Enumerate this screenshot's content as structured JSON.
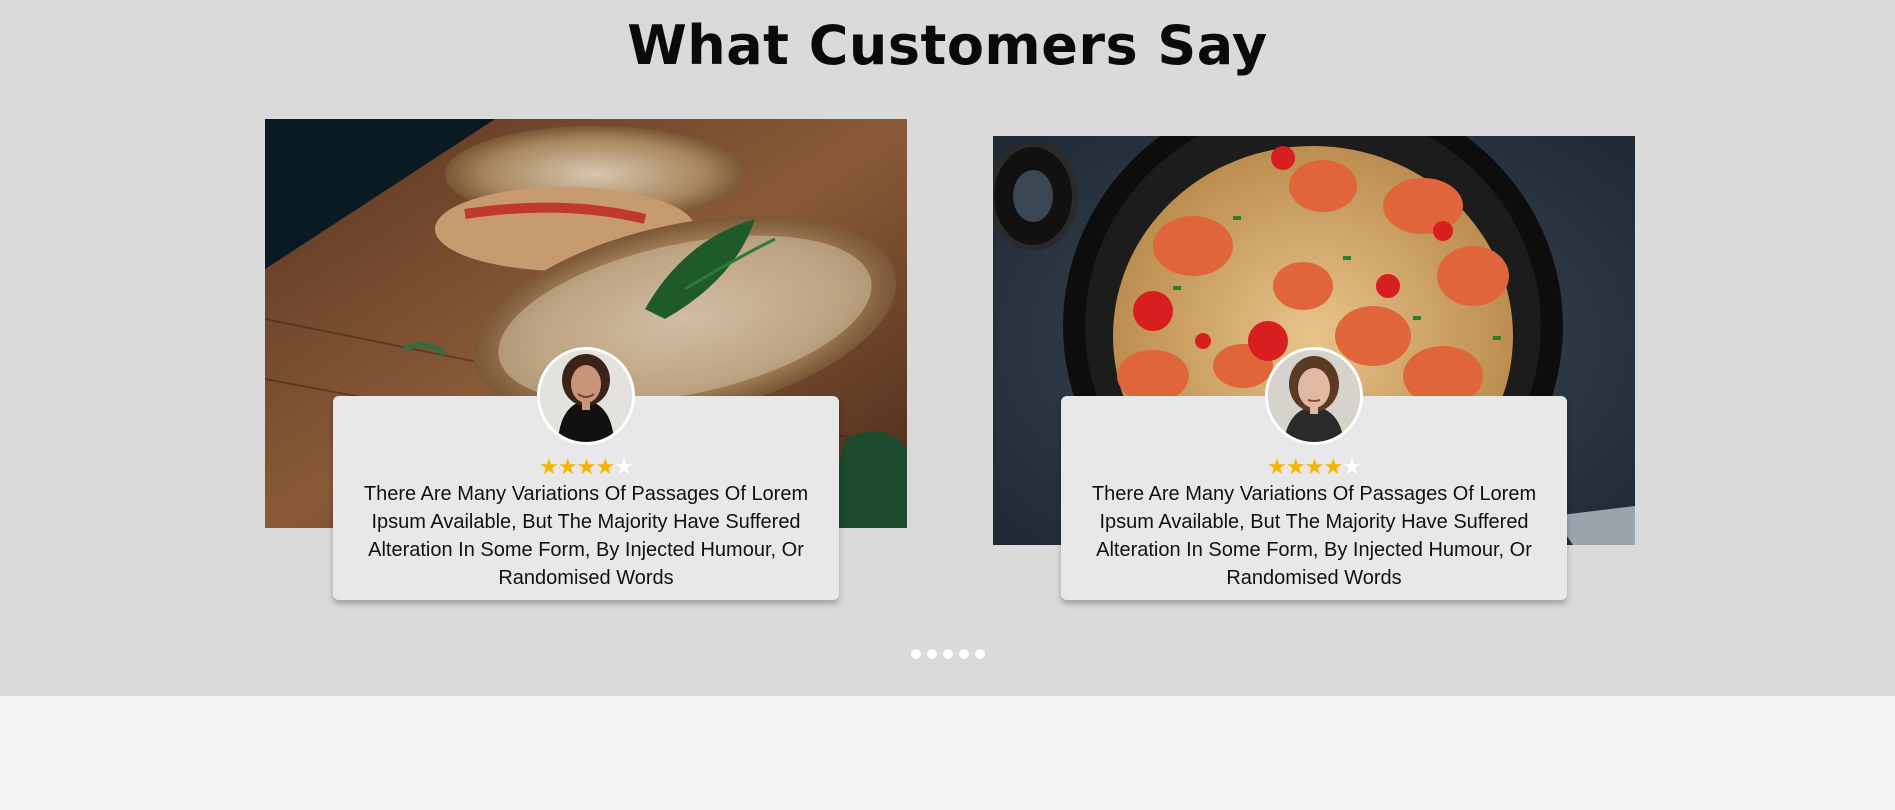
{
  "section": {
    "title": "What Customers Say"
  },
  "testimonials": [
    {
      "photo_icon": "toasted-bread-photo",
      "avatar_icon": "woman-smiling-avatar",
      "rating": 4,
      "rating_max": 5,
      "quote": "There Are Many Variations Of Passages Of Lorem Ipsum Available, But The Majority Have Suffered Alteration In Some Form, By Injected Humour, Or Randomised Words"
    },
    {
      "photo_icon": "shrimp-spaghetti-photo",
      "avatar_icon": "woman-portrait-avatar",
      "rating": 4,
      "rating_max": 5,
      "quote": "There Are Many Variations Of Passages Of Lorem Ipsum Available, But The Majority Have Suffered Alteration In Some Form, By Injected Humour, Or Randomised Words"
    }
  ],
  "pagination": {
    "count": 5
  },
  "colors": {
    "section_bg": "#dadada",
    "card_bg": "#e8e8e8",
    "star_filled": "#f5b400",
    "star_empty": "#ffffff",
    "footer_bg": "#f5f5f5"
  }
}
